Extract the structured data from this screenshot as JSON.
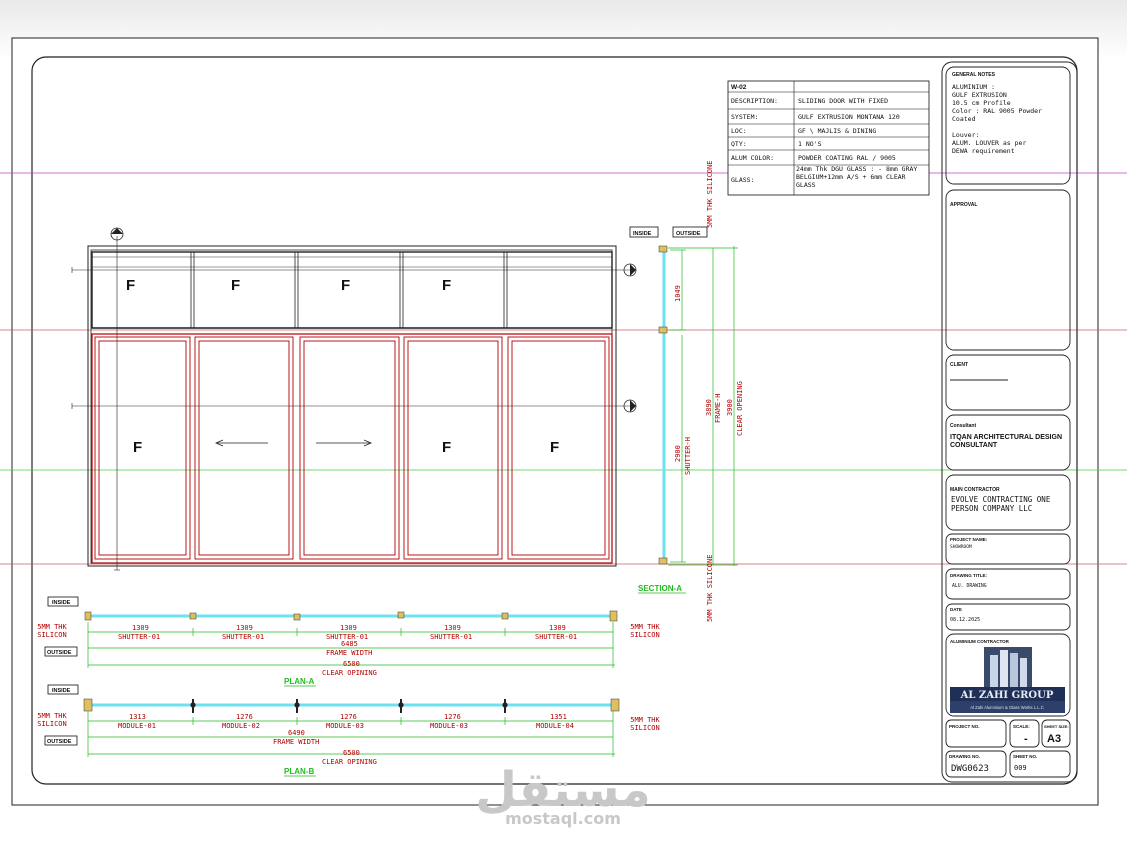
{
  "spec": {
    "code": "W-02",
    "rows": [
      {
        "label": "DESCRIPTION:",
        "value": "SLIDING DOOR WITH FIXED"
      },
      {
        "label": "SYSTEM:",
        "value": "GULF EXTRUSION MONTANA 120"
      },
      {
        "label": "LOC:",
        "value": "GF \\ MAJLIS & DINING"
      },
      {
        "label": "QTY:",
        "value": "1 NO'S"
      },
      {
        "label": "ALUM COLOR:",
        "value": "POWDER COATING RAL / 9005"
      },
      {
        "label": "GLASS:",
        "value": "24mm Thk DGU GLASS : - 8mm GRAY BELGIUM+12mm A/S + 6mm CLEAR GLASS"
      }
    ]
  },
  "elevation": {
    "fixed_label": "F",
    "inside_tag": "INSIDE",
    "outside_tag": "OUTSIDE",
    "silicone_label": "5MM THK SILICONE",
    "dim_top": "1049",
    "dim_shutter": "2900",
    "dim_shutter_label": "SHUTTER-H",
    "dim_frame": "3890",
    "dim_frame_label": "FRAME-H",
    "dim_clear": "3900",
    "dim_clear_label": "CLEAR OPENING",
    "section_label": "SECTION-A"
  },
  "plan_a": {
    "title": "PLAN-A",
    "inside_tag": "INSIDE",
    "outside_tag": "OUTSIDE",
    "silicon_left": "5MM THK SILICON",
    "silicon_right": "5MM THK SILICON",
    "segments": [
      {
        "dim": "1309",
        "label": "SHUTTER-01"
      },
      {
        "dim": "1309",
        "label": "SHUTTER-01"
      },
      {
        "dim": "1309",
        "label": "SHUTTER-01"
      },
      {
        "dim": "1309",
        "label": "SHUTTER-01"
      },
      {
        "dim": "1309",
        "label": "SHUTTER-01"
      }
    ],
    "frame_dim": "6485",
    "frame_label": "FRAME WIDTH",
    "clear_dim": "6500",
    "clear_label": "CLEAR OPINING"
  },
  "plan_b": {
    "title": "PLAN-B",
    "inside_tag": "INSIDE",
    "outside_tag": "OUTSIDE",
    "silicon_left": "5MM THK SILICON",
    "silicon_right": "5MM THK SILICON",
    "segments": [
      {
        "dim": "1313",
        "label": "MODULE-01"
      },
      {
        "dim": "1276",
        "label": "MODULE-02"
      },
      {
        "dim": "1276",
        "label": "MODULE-03"
      },
      {
        "dim": "1276",
        "label": "MODULE-03"
      },
      {
        "dim": "1351",
        "label": "MODULE-04"
      }
    ],
    "frame_dim": "6490",
    "frame_label": "FRAME WIDTH",
    "clear_dim": "6500",
    "clear_label": "CLEAR OPINING"
  },
  "titleblock": {
    "notes_title": "GENERAL NOTES",
    "notes": [
      "ALUMINIUM :",
      "GULF EXTRUSION",
      "10.5 cm Profile",
      "Color : RAL 9005 Powder",
      "Coated",
      "",
      "Louver:",
      "ALUM. LOUVER as per",
      "DEWA requirement"
    ],
    "approval_label": "APPROVAL",
    "client_label": "CLIENT",
    "consultant_label": "Consultant",
    "consultant_name": [
      "ITQAN ARCHITECTURAL DESIGN",
      "CONSULTANT"
    ],
    "contractor_label": "MAIN CONTRACTOR",
    "contractor_name": [
      "EVOLVE CONTRACTING ONE",
      "PERSON COMPANY LLC"
    ],
    "project_label": "PROJECT NAME:",
    "project_value": "SHOWROOM",
    "drawing_title_label": "DRAWING TITLE:",
    "drawing_title_value": "ALU. DRAWING",
    "date_label": "DATE",
    "date_value": "08.12.2025",
    "alu_contractor_label": "ALUMINIUM CONTRACTOR",
    "logo_name": "AL ZAHI GROUP",
    "logo_sub": "Al Zahi Aluminium & Glass Works L.L.C",
    "project_no_label": "PROJECT NO.",
    "scale_label": "SCALE:",
    "scale_value": "-",
    "sheet_size_label": "SHEET SIZE:",
    "sheet_size_value": "A3",
    "drawing_no_label": "DRAWING NO.",
    "drawing_no_value": "DWG0623",
    "sheet_no_label": "SHEET NO.",
    "sheet_no_value": "009"
  },
  "watermark": {
    "arabic": "مستقل",
    "latin": "mostaql.com"
  },
  "colors": {
    "frame": "#b30000",
    "glass": "#6ee0f0",
    "dim": "#22bb22",
    "magenta": "#c040c0",
    "red_line": "#c06060"
  }
}
